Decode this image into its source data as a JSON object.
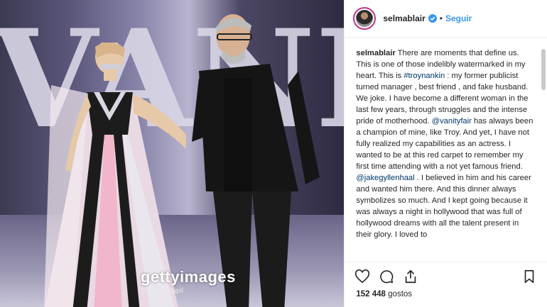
{
  "photo": {
    "watermark_brand": "gettyimages",
    "credit": "Dia Dipasupil",
    "wall_letters": "VANITY"
  },
  "header": {
    "username": "selmablair",
    "separator": "•",
    "follow_label": "Seguir"
  },
  "caption": {
    "author": "selmablair",
    "text_1": " There are moments that define us. This is one of those indelibly watermarked in my heart. This is ",
    "mention_1": "#troynankin",
    "text_2": " : my former publicist turned manager , best friend , and fake husband. We joke. I have become a different woman in the last few years, through struggles and the intense pride of motherhood. ",
    "mention_2": "@vanityfair",
    "text_3": " has always been a champion of mine, like Troy. And yet, I have not fully realized my capabilities as an actress. I wanted to be at this red carpet to remember my first time attending with a not yet famous friend. ",
    "mention_3": "@jakegyllenhaal",
    "text_4": " . I believed in him and his career and wanted him there. And this dinner always symbolizes so much. And I kept going because it was always a night in hollywood that was full of hollywood dreams with all the talent present in their glory. I loved to"
  },
  "actions": {
    "like_icon": "heart-icon",
    "comment_icon": "comment-icon",
    "share_icon": "share-icon",
    "save_icon": "bookmark-icon"
  },
  "likes": {
    "count": "152 448",
    "label": "gostos"
  },
  "colors": {
    "link": "#003569",
    "follow": "#3897f0",
    "verified": "#3897f0"
  }
}
